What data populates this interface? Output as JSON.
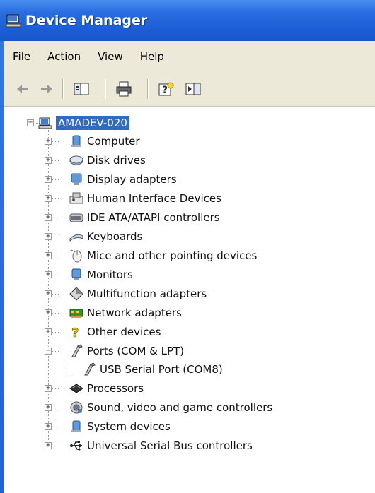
{
  "window": {
    "title": "Device Manager"
  },
  "menu": [
    {
      "label_u": "F",
      "label_rest": "ile"
    },
    {
      "label_u": "A",
      "label_rest": "ction"
    },
    {
      "label_u": "V",
      "label_rest": "iew"
    },
    {
      "label_u": "H",
      "label_rest": "elp"
    }
  ],
  "toolbar": {
    "back_icon": "back-arrow-icon",
    "forward_icon": "forward-arrow-icon",
    "buttons": [
      "show-hide-console-tree-icon",
      "print-icon",
      "help-icon",
      "show-hide-action-pane-icon"
    ]
  },
  "tree": {
    "root": "AMADEV-020",
    "categories": [
      {
        "label": "Computer",
        "expanded": false
      },
      {
        "label": "Disk drives",
        "expanded": false
      },
      {
        "label": "Display adapters",
        "expanded": false
      },
      {
        "label": "Human Interface Devices",
        "expanded": false
      },
      {
        "label": "IDE ATA/ATAPI controllers",
        "expanded": false
      },
      {
        "label": "Keyboards",
        "expanded": false
      },
      {
        "label": "Mice and other pointing devices",
        "expanded": false
      },
      {
        "label": "Monitors",
        "expanded": false
      },
      {
        "label": "Multifunction adapters",
        "expanded": false
      },
      {
        "label": "Network adapters",
        "expanded": false
      },
      {
        "label": "Other devices",
        "expanded": false
      },
      {
        "label": "Ports (COM & LPT)",
        "expanded": true,
        "children": [
          "USB Serial Port (COM8)"
        ]
      },
      {
        "label": "Processors",
        "expanded": false
      },
      {
        "label": "Sound, video and game controllers",
        "expanded": false
      },
      {
        "label": "System devices",
        "expanded": false
      },
      {
        "label": "Universal Serial Bus controllers",
        "expanded": false
      }
    ]
  }
}
